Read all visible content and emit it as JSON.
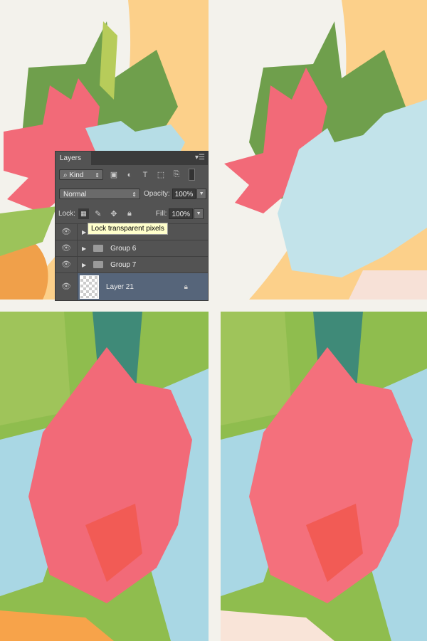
{
  "layers_panel": {
    "tab_title": "Layers",
    "filter": {
      "label": "Kind",
      "icons": [
        "image-filter-icon",
        "adjustment-filter-icon",
        "type-filter-icon",
        "shape-filter-icon",
        "smart-object-filter-icon"
      ]
    },
    "blend_mode": "Normal",
    "opacity_label": "Opacity:",
    "opacity_value": "100%",
    "lock_label": "Lock:",
    "lock_icons": [
      "lock-transparent-icon",
      "lock-image-icon",
      "lock-position-icon",
      "lock-all-icon"
    ],
    "fill_label": "Fill:",
    "fill_value": "100%",
    "tooltip": "Lock transparent pixels",
    "layers": [
      {
        "name": "",
        "type": "group"
      },
      {
        "name": "Group 6",
        "type": "group"
      },
      {
        "name": "Group 7",
        "type": "group"
      },
      {
        "name": "Layer 21",
        "type": "layer",
        "selected": true,
        "locked": true
      }
    ]
  },
  "colors": {
    "background": "#f3f2ec",
    "pink": "#f26a78",
    "blue": "#b6dde6",
    "green": "#7faa4e",
    "orange": "#f7a34a",
    "panel": "#535353",
    "selected": "#56657a"
  }
}
